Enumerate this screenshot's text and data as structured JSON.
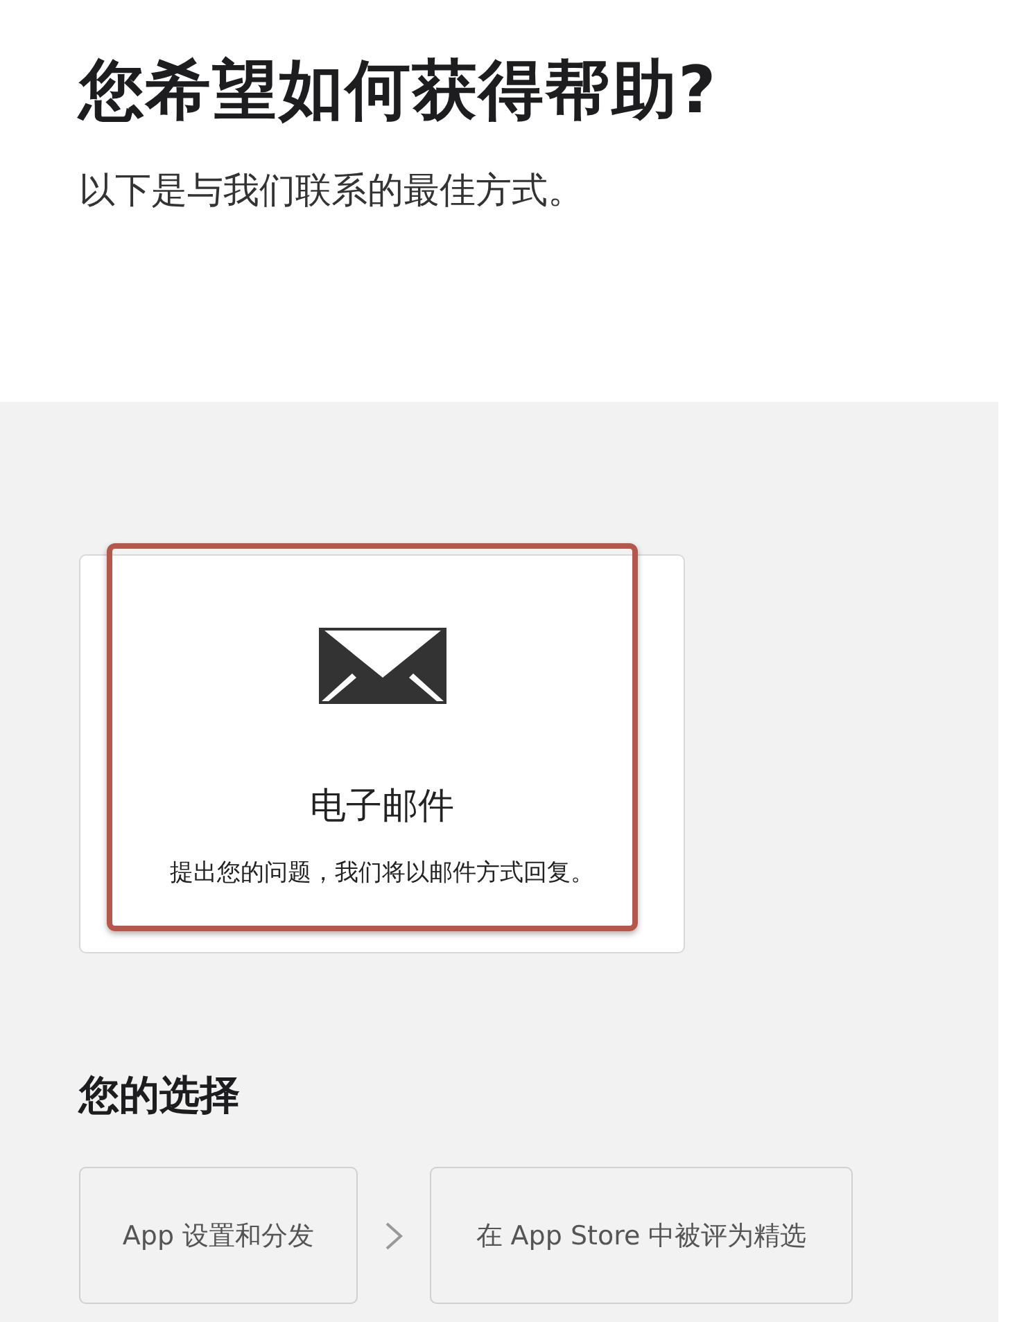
{
  "title": "您希望如何获得帮助?",
  "subtitle": "以下是与我们联系的最佳方式。",
  "contact_card": {
    "title": "电子邮件",
    "description": "提出您的问题，我们将以邮件方式回复。",
    "highlighted": true
  },
  "choices": {
    "heading": "您的选择",
    "steps": [
      {
        "label": "App 设置和分发"
      },
      {
        "label": "在 App Store 中被评为精选"
      }
    ]
  }
}
